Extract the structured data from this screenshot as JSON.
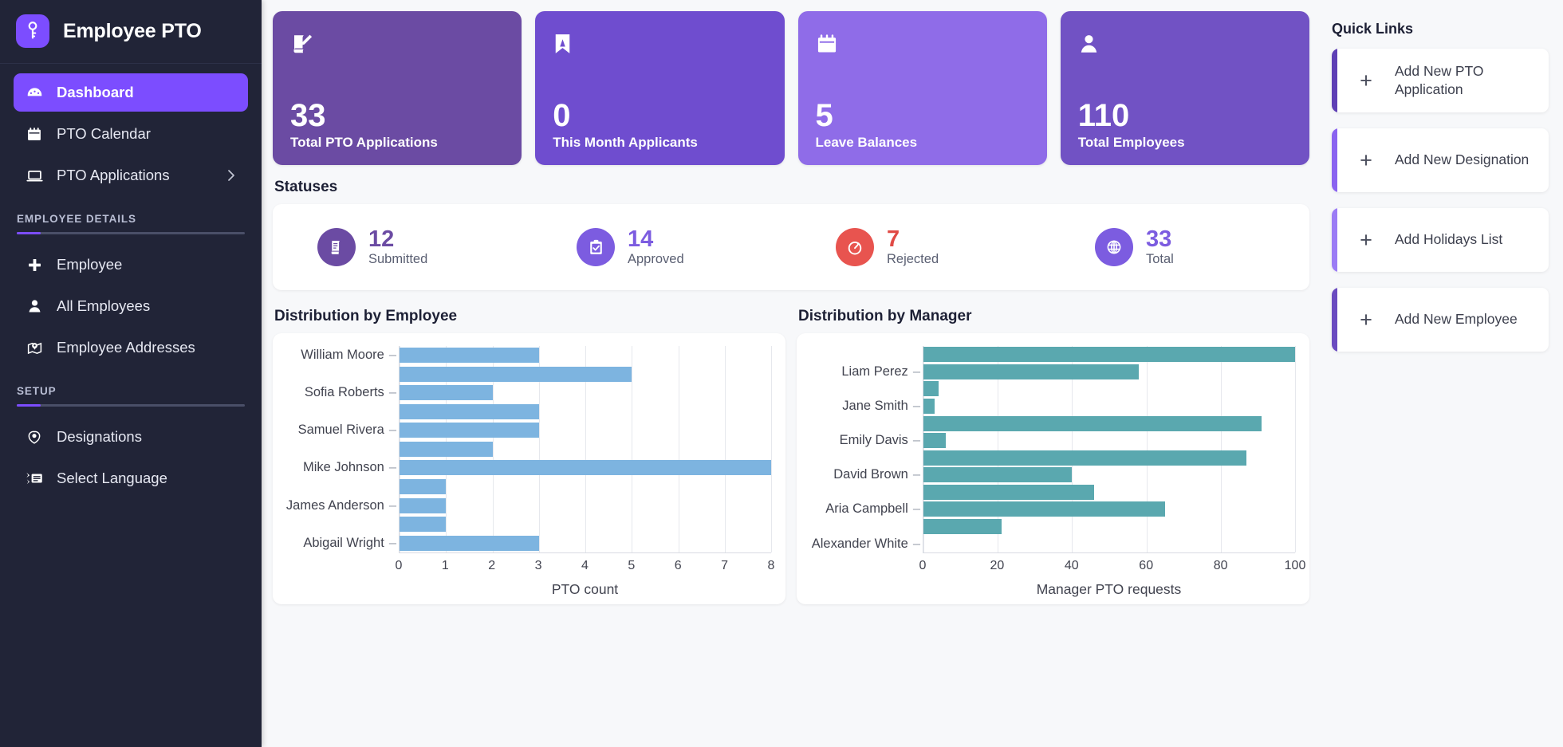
{
  "sidebar": {
    "brand": {
      "title": "Employee PTO",
      "logo_icon": "key-icon"
    },
    "nav": [
      {
        "label": "Dashboard",
        "icon": "dashboard-gauge-icon",
        "active": true
      },
      {
        "label": "PTO Calendar",
        "icon": "calendar-icon",
        "active": false
      },
      {
        "label": "PTO Applications",
        "icon": "laptop-icon",
        "active": false,
        "chevron": "chevron-right-icon"
      }
    ],
    "sections": [
      {
        "label": "EMPLOYEE DETAILS",
        "items": [
          {
            "label": "Employee",
            "icon": "plus-icon"
          },
          {
            "label": "All Employees",
            "icon": "person-icon"
          },
          {
            "label": "Employee Addresses",
            "icon": "map-pin-icon"
          }
        ]
      },
      {
        "label": "SETUP",
        "items": [
          {
            "label": "Designations",
            "icon": "badge-shield-icon"
          },
          {
            "label": "Select Language",
            "icon": "translate-icon"
          }
        ]
      }
    ]
  },
  "kpis": [
    {
      "value": "33",
      "label": "Total PTO Applications",
      "icon": "scroll-edit-icon",
      "color": "#6b4ba3"
    },
    {
      "value": "0",
      "label": "This Month Applicants",
      "icon": "bookmark-icon",
      "color": "#6f4dcf"
    },
    {
      "value": "5",
      "label": "Leave Balances",
      "icon": "calendar-icon",
      "color": "#8f6ce8"
    },
    {
      "value": "110",
      "label": "Total Employees",
      "icon": "person-icon",
      "color": "#7152c4"
    }
  ],
  "statuses": {
    "title": "Statuses",
    "items": [
      {
        "value": "12",
        "label": "Submitted",
        "icon": "scroll-doc-icon",
        "circle_color": "#6b4ba3",
        "value_color": "#6b4ba3"
      },
      {
        "value": "14",
        "label": "Approved",
        "icon": "clipboard-check-icon",
        "circle_color": "#7c5ce0",
        "value_color": "#7c5ce0"
      },
      {
        "value": "7",
        "label": "Rejected",
        "icon": "stopwatch-icon",
        "circle_color": "#e8544f",
        "value_color": "#e04a45"
      },
      {
        "value": "33",
        "label": "Total",
        "icon": "globe-icon",
        "circle_color": "#7c5ce0",
        "value_color": "#7c5ce0"
      }
    ]
  },
  "quick_links": {
    "title": "Quick Links",
    "items": [
      {
        "label": "Add New PTO Application",
        "icon": "plus-icon",
        "accent": "#5e3fb5"
      },
      {
        "label": "Add New Designation",
        "icon": "plus-icon",
        "accent": "#8a63f0"
      },
      {
        "label": "Add Holidays List",
        "icon": "plus-icon",
        "accent": "#9b7cf5"
      },
      {
        "label": "Add New Employee",
        "icon": "plus-icon",
        "accent": "#6a4bc0"
      }
    ]
  },
  "chart_data": [
    {
      "type": "bar",
      "orientation": "horizontal",
      "title": "Distribution by Employee",
      "xlabel": "PTO count",
      "ylabel": "",
      "xlim": [
        0,
        8
      ],
      "xticks": [
        0,
        1,
        2,
        3,
        4,
        5,
        6,
        7,
        8
      ],
      "grid": true,
      "bar_color": "#7db4e0",
      "categories": [
        "William Moore",
        "",
        "Sofia Roberts",
        "",
        "Samuel Rivera",
        "",
        "Mike Johnson",
        "",
        "James Anderson",
        "",
        "Abigail Wright"
      ],
      "tick_labels": [
        "William Moore",
        "Sofia Roberts",
        "Samuel Rivera",
        "Mike Johnson",
        "James Anderson",
        "Abigail Wright"
      ],
      "values": [
        3,
        5,
        2,
        3,
        3,
        2,
        8,
        1,
        1,
        1,
        3
      ]
    },
    {
      "type": "bar",
      "orientation": "horizontal",
      "title": "Distribution by Manager",
      "xlabel": "Manager PTO requests",
      "ylabel": "",
      "xlim": [
        0,
        100
      ],
      "xticks": [
        0,
        20,
        40,
        60,
        80,
        100
      ],
      "grid": true,
      "bar_color": "#5aa8af",
      "categories": [
        "",
        "Liam Perez",
        "",
        "Jane Smith",
        "",
        "Emily Davis",
        "",
        "David Brown",
        "",
        "Aria Campbell",
        "",
        "Alexander White"
      ],
      "tick_labels": [
        "Liam Perez",
        "Jane Smith",
        "Emily Davis",
        "David Brown",
        "Aria Campbell",
        "Alexander White"
      ],
      "values": [
        100,
        58,
        4,
        3,
        91,
        6,
        87,
        40,
        46,
        65,
        21,
        0
      ]
    }
  ]
}
